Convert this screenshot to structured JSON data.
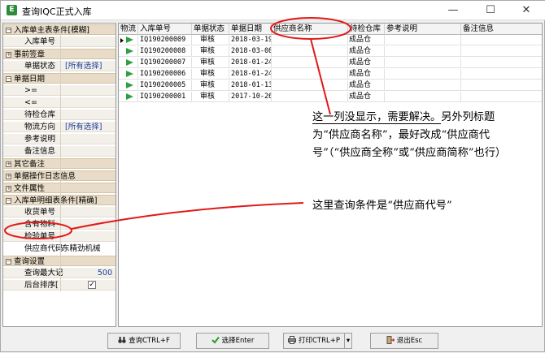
{
  "window": {
    "title": "查询IQC正式入库",
    "app_icon": "E",
    "controls": {
      "minimize": "—",
      "maximize": "☐",
      "close": "✕"
    }
  },
  "left_panel": {
    "rows": [
      {
        "kind": "hdr",
        "toggle": "−",
        "label": "入库单主表条件[模糊]"
      },
      {
        "kind": "item",
        "label": "入库单号"
      },
      {
        "kind": "hdr",
        "toggle": "+",
        "label": "事前签章"
      },
      {
        "kind": "item",
        "label": "单据状态",
        "value2": "[所有选择]"
      },
      {
        "kind": "hdr",
        "toggle": "−",
        "label": "单据日期"
      },
      {
        "kind": "item",
        "label": ">="
      },
      {
        "kind": "item",
        "label": "<="
      },
      {
        "kind": "item",
        "label": "待检仓库"
      },
      {
        "kind": "item",
        "label": "物流方向",
        "value2": "[所有选择]"
      },
      {
        "kind": "item",
        "label": "参考说明"
      },
      {
        "kind": "item",
        "label": "备注信息"
      },
      {
        "kind": "hdr",
        "toggle": "+",
        "label": "其它备注"
      },
      {
        "kind": "hdr",
        "toggle": "+",
        "label": "单据操作日志信息"
      },
      {
        "kind": "hdr",
        "toggle": "+",
        "label": "文件属性"
      },
      {
        "kind": "hdr",
        "toggle": "−",
        "label": "入库单明细表条件[精确]"
      },
      {
        "kind": "item",
        "label": "收货单号"
      },
      {
        "kind": "item",
        "label": "含有物料"
      },
      {
        "kind": "item",
        "label": "检验单号"
      },
      {
        "kind": "sel",
        "label": "供应商代码",
        "value": "东精劲机械"
      },
      {
        "kind": "hdr",
        "toggle": "−",
        "label": "查询设置"
      },
      {
        "kind": "item",
        "label": "查询最大记",
        "valueR": "500"
      },
      {
        "kind": "item",
        "label": "后台排序[",
        "checkbox": "✓"
      }
    ]
  },
  "grid": {
    "columns": [
      {
        "key": "flag",
        "label": "物流"
      },
      {
        "key": "no",
        "label": "入库单号"
      },
      {
        "key": "status",
        "label": "单据状态"
      },
      {
        "key": "date",
        "label": "单据日期"
      },
      {
        "key": "supplier",
        "label": "供应商名称"
      },
      {
        "key": "wh",
        "label": "待检仓库"
      },
      {
        "key": "ref",
        "label": "参考说明"
      },
      {
        "key": "note",
        "label": "备注信息"
      }
    ],
    "rows": [
      {
        "no": "IQ190200009",
        "status": "审核",
        "date": "2018-03-19",
        "supplier": "",
        "wh": "成品仓",
        "ref": "",
        "note": ""
      },
      {
        "no": "IQ190200008",
        "status": "审核",
        "date": "2018-03-08",
        "supplier": "",
        "wh": "成品仓",
        "ref": "",
        "note": ""
      },
      {
        "no": "IQ190200007",
        "status": "审核",
        "date": "2018-01-24",
        "supplier": "",
        "wh": "成品仓",
        "ref": "",
        "note": ""
      },
      {
        "no": "IQ190200006",
        "status": "审核",
        "date": "2018-01-24",
        "supplier": "",
        "wh": "成品仓",
        "ref": "",
        "note": ""
      },
      {
        "no": "IQ190200005",
        "status": "审核",
        "date": "2018-01-13",
        "supplier": "",
        "wh": "成品仓",
        "ref": "",
        "note": ""
      },
      {
        "no": "IQ190200001",
        "status": "审核",
        "date": "2017-10-26",
        "supplier": "",
        "wh": "成品仓",
        "ref": "",
        "note": ""
      }
    ],
    "selected_row": 0
  },
  "buttons": {
    "query": "查询CTRL+F",
    "select": "选择Enter",
    "print": "打印CTRL+P",
    "print_dropdown": "▾",
    "exit": "退出Esc"
  },
  "annotations": {
    "note1_underlined": "这一列没显示，需要解决。",
    "note1_rest": "另外列标题为“供应商名称”，最好改成“供应商代号”（“供应商全称”或“供应商简称”也行）",
    "note2": "这里查询条件是“供应商代号”",
    "mark_color": "#e11919"
  },
  "colors": {
    "header_band": "#e8dcc8",
    "row_arrow": "#2ea043",
    "blue_value": "#1a3e9c"
  }
}
